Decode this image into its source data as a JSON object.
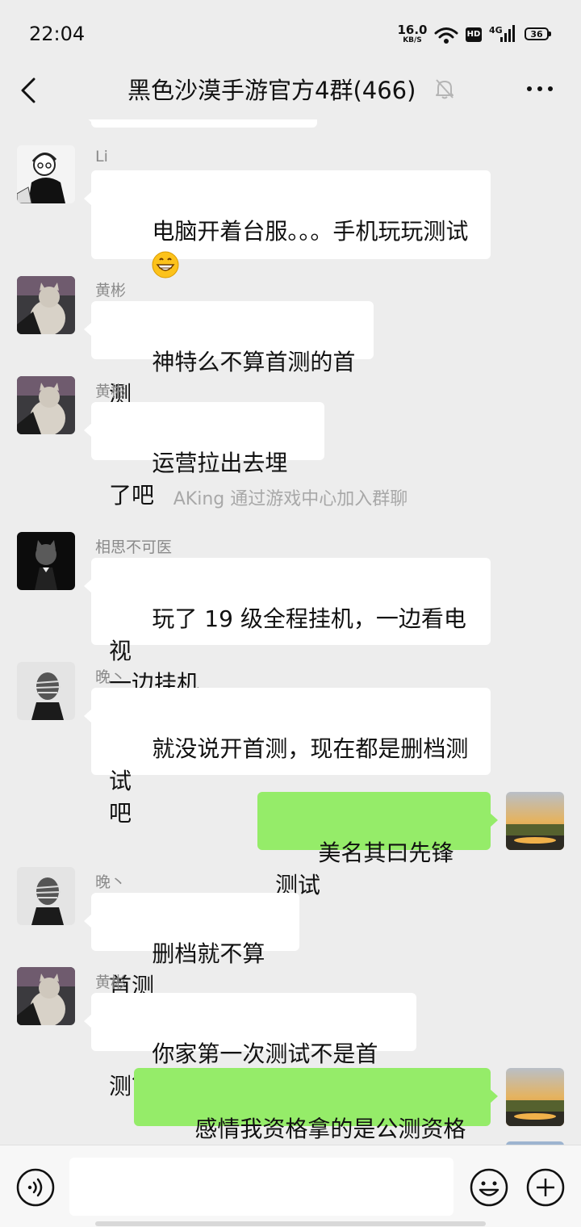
{
  "status_bar": {
    "time": "22:04",
    "net_speed_value": "16.0",
    "net_speed_unit": "KB/S",
    "wifi_icon": "wifi-icon",
    "hd_badge": "HD",
    "network_type": "4G",
    "battery_level": "36"
  },
  "header": {
    "title": "黑色沙漠手游官方4群(466)",
    "back_icon": "back-arrow-icon",
    "mute_icon": "muted-bell-icon",
    "more_icon": "more-dots-icon"
  },
  "messages": [
    {
      "type": "incoming",
      "sender": "Li",
      "text": "电脑开着台服。。。手机玩玩测试",
      "emoji": "grinning-face-emoji"
    },
    {
      "type": "incoming",
      "sender": "黄彬",
      "text": "神特么不算首测的首测"
    },
    {
      "type": "incoming",
      "sender": "黄彬",
      "text": "运营拉出去埋了吧"
    },
    {
      "type": "system",
      "text": "AKing 通过游戏中心加入群聊"
    },
    {
      "type": "incoming",
      "sender": "相思不可医",
      "text": "玩了 19 级全程挂机，一边看电视\n一边挂机"
    },
    {
      "type": "incoming",
      "sender": "晚丶",
      "text": "就没说开首测，现在都是删档测试\n吧"
    },
    {
      "type": "outgoing",
      "text": "美名其曰先锋测试"
    },
    {
      "type": "incoming",
      "sender": "晚丶",
      "text": "删档就不算首测"
    },
    {
      "type": "incoming",
      "sender": "黄彬",
      "text": "你家第一次测试不是首测？"
    },
    {
      "type": "outgoing",
      "text": "感情我资格拿的是公测资格呗"
    }
  ],
  "input_bar": {
    "voice_icon": "voice-input-icon",
    "input_value": "",
    "emoji_icon": "emoji-icon",
    "plus_icon": "plus-icon"
  },
  "colors": {
    "background": "#ededed",
    "outgoing_bubble": "#95ec69",
    "incoming_bubble": "#ffffff"
  }
}
